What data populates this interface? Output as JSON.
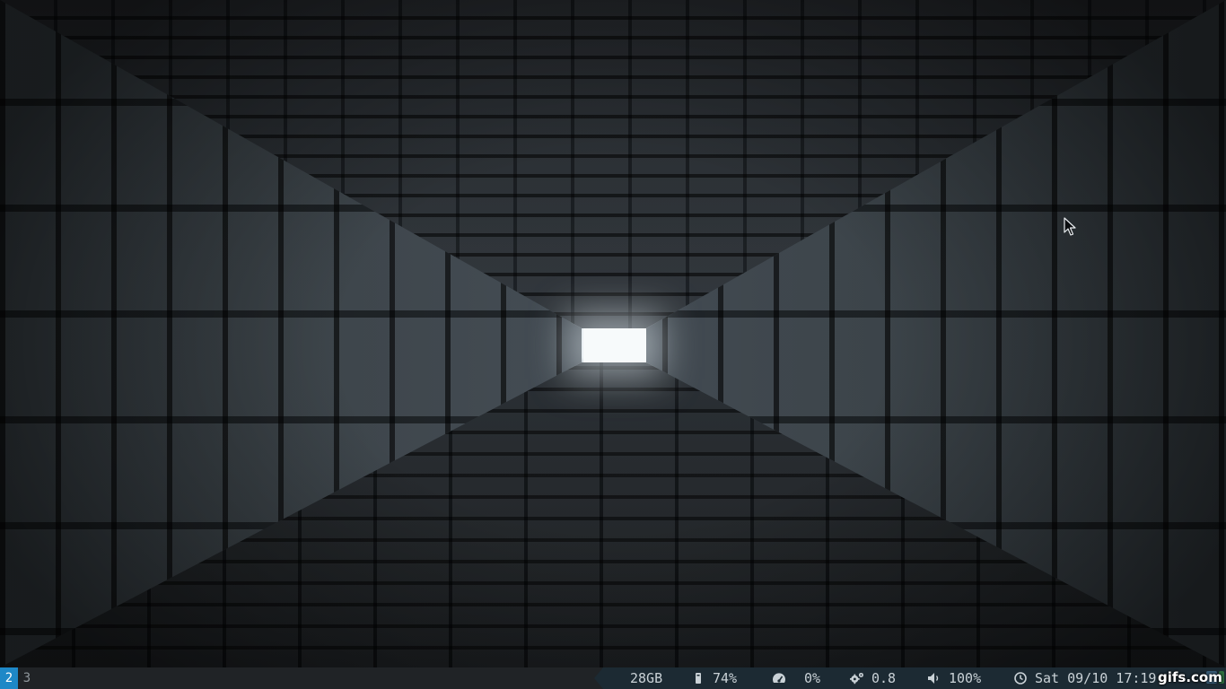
{
  "desktop": {
    "wallpaper": "dark cubic tunnel with bright light at the end"
  },
  "statusbar": {
    "workspaces": [
      {
        "label": "2",
        "active": true
      },
      {
        "label": "3",
        "active": false
      }
    ],
    "disk": {
      "icon": "hard-drive-icon",
      "value": "28GB"
    },
    "memory": {
      "icon": "memory-icon",
      "value": "74%"
    },
    "cpu": {
      "icon": "speedometer-icon",
      "value": "0%"
    },
    "load": {
      "icon": "gears-icon",
      "value": "0.8"
    },
    "volume": {
      "icon": "speaker-icon",
      "value": "100%"
    },
    "clock": {
      "icon": "clock-icon",
      "value": "Sat 09/10 17:19"
    },
    "colors": {
      "bar_bg": "#202326",
      "active_workspace": "#1e88c7",
      "blocks_bg": "#1c2a33"
    }
  },
  "watermark": {
    "text": "gifs.com"
  }
}
